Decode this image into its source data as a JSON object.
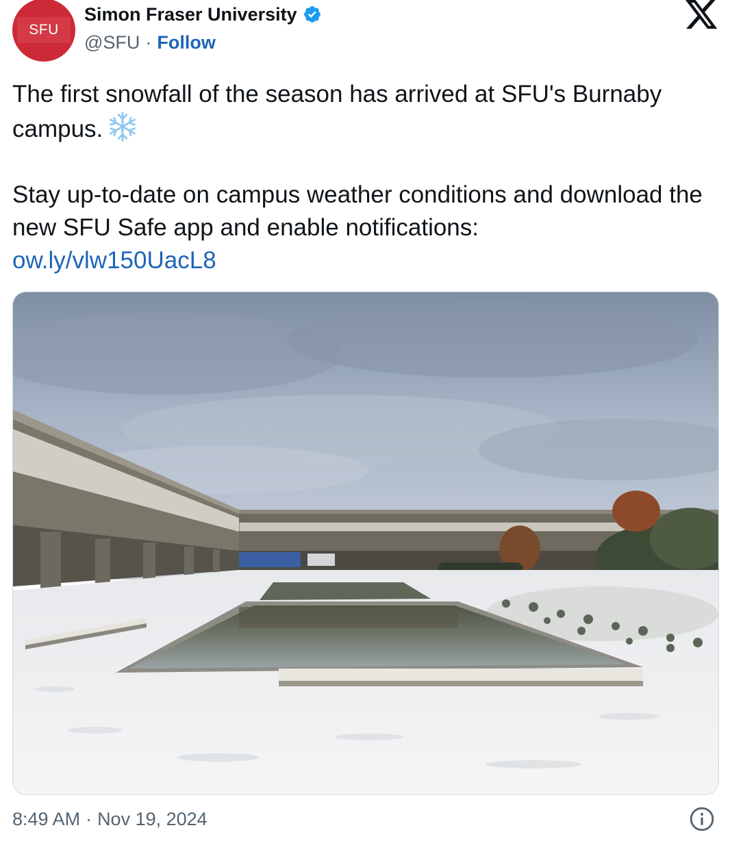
{
  "author": {
    "display_name": "Simon Fraser University",
    "handle": "@SFU",
    "separator": "·",
    "follow_label": "Follow",
    "avatar_text": "SFU",
    "verified": true
  },
  "tweet": {
    "line1": "The first snowfall of the season has arrived at SFU's Burnaby campus.",
    "snowflake_emoji": "snowflake-icon",
    "line2": "Stay up-to-date on campus weather conditions and download the new SFU Safe app and enable notifications:",
    "link_text": "ow.ly/vlw150UacL8"
  },
  "footer": {
    "time": "8:49 AM",
    "separator": "·",
    "date": "Nov 19, 2024"
  },
  "colors": {
    "avatar_red": "#cc2a36",
    "verified_blue": "#1d9bf0",
    "link_blue": "#1d64b8",
    "secondary_text": "#536471"
  }
}
